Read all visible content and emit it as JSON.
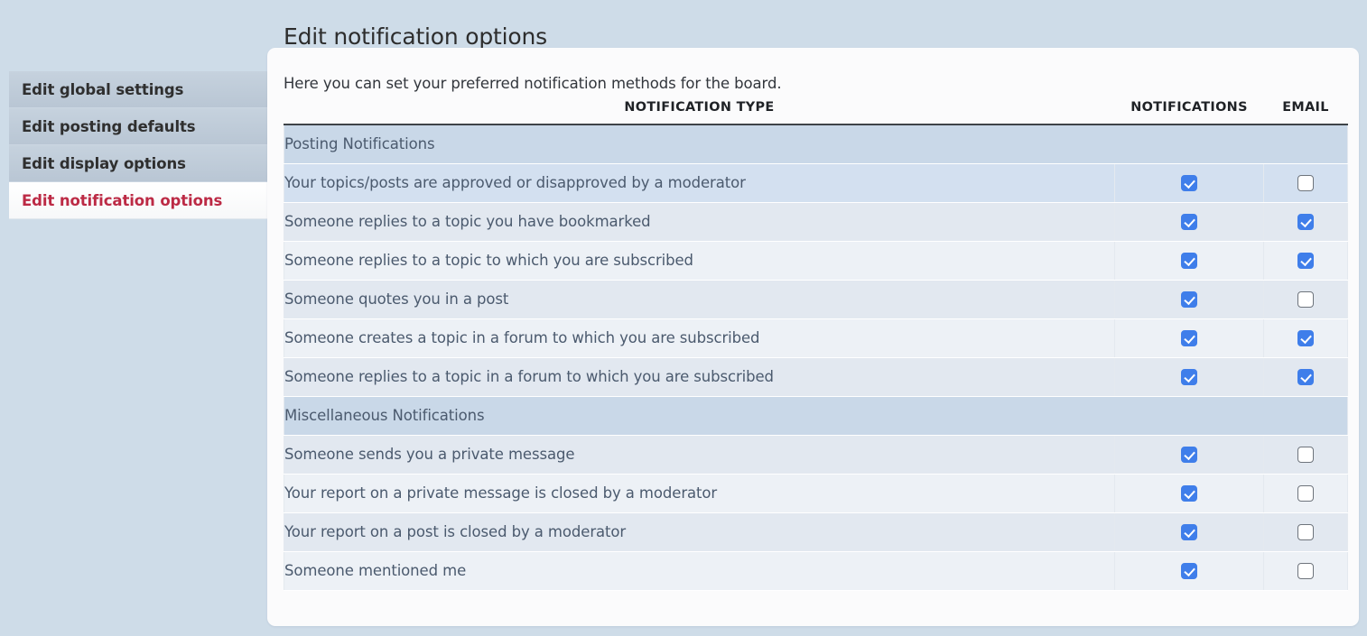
{
  "page": {
    "title": "Edit notification options",
    "background_color": "#cedce8"
  },
  "sidebar": {
    "items": [
      {
        "label": "Edit global settings",
        "active": false
      },
      {
        "label": "Edit posting defaults",
        "active": false
      },
      {
        "label": "Edit display options",
        "active": false
      },
      {
        "label": "Edit notification options",
        "active": true
      }
    ],
    "active_color": "#bc2a45"
  },
  "panel": {
    "intro": "Here you can set your preferred notification methods for the board."
  },
  "table": {
    "columns": [
      "Notification type",
      "Notifications",
      "Email"
    ],
    "rows": [
      {
        "kind": "section",
        "label": "Posting Notifications"
      },
      {
        "kind": "row",
        "style": "highlight",
        "label": "Your topics/posts are approved or disapproved by a moderator",
        "notifications": true,
        "email": false
      },
      {
        "kind": "row",
        "style": "odd",
        "label": "Someone replies to a topic you have bookmarked",
        "notifications": true,
        "email": true
      },
      {
        "kind": "row",
        "style": "even",
        "label": "Someone replies to a topic to which you are subscribed",
        "notifications": true,
        "email": true
      },
      {
        "kind": "row",
        "style": "odd",
        "label": "Someone quotes you in a post",
        "notifications": true,
        "email": false
      },
      {
        "kind": "row",
        "style": "even",
        "label": "Someone creates a topic in a forum to which you are subscribed",
        "notifications": true,
        "email": true
      },
      {
        "kind": "row",
        "style": "odd",
        "label": "Someone replies to a topic in a forum to which you are subscribed",
        "notifications": true,
        "email": true
      },
      {
        "kind": "section",
        "label": "Miscellaneous Notifications"
      },
      {
        "kind": "row",
        "style": "odd",
        "label": "Someone sends you a private message",
        "notifications": true,
        "email": false
      },
      {
        "kind": "row",
        "style": "even",
        "label": "Your report on a private message is closed by a moderator",
        "notifications": true,
        "email": false
      },
      {
        "kind": "row",
        "style": "odd",
        "label": "Your report on a post is closed by a moderator",
        "notifications": true,
        "email": false
      },
      {
        "kind": "row",
        "style": "even",
        "label": "Someone mentioned me",
        "notifications": true,
        "email": false
      }
    ]
  },
  "colors": {
    "checkbox_checked": "#3f7eea",
    "section_row": "#c9d8e8",
    "highlight_row": "#d3e0f0",
    "text": "#4b5a6e"
  }
}
